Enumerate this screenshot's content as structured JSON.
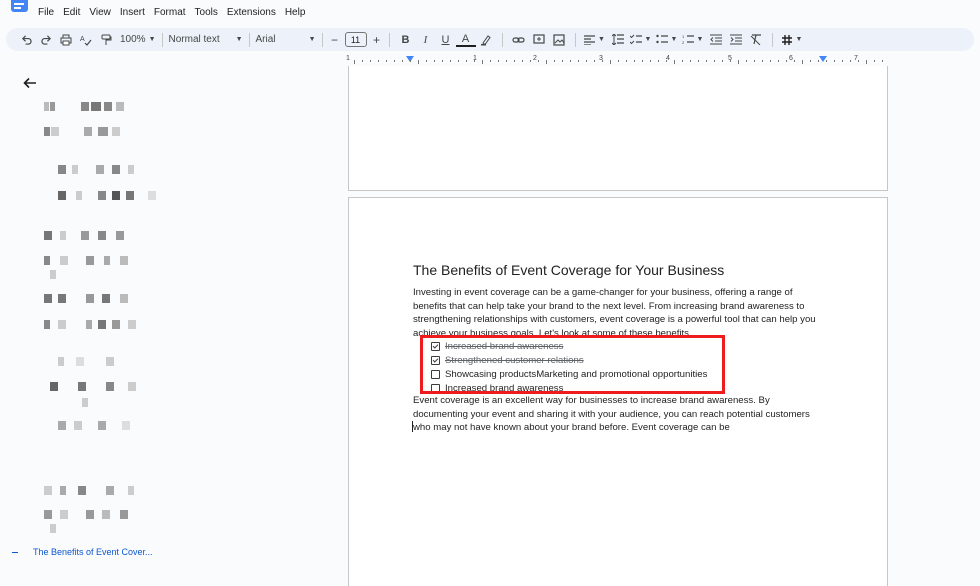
{
  "menu": [
    "File",
    "Edit",
    "View",
    "Insert",
    "Format",
    "Tools",
    "Extensions",
    "Help"
  ],
  "toolbar": {
    "zoom": "100%",
    "style": "Normal text",
    "font": "Arial",
    "font_size": "11",
    "minus": "−",
    "plus": "+"
  },
  "ruler": {
    "numbers": [
      "1",
      "1",
      "2",
      "3",
      "4",
      "5",
      "6",
      "7"
    ]
  },
  "sidebar": {
    "active_heading": "The Benefits of Event Cover..."
  },
  "document": {
    "title": "The Benefits of Event Coverage for Your Business",
    "paragraph1": "Investing in event coverage can be a game-changer for your business, offering a range of benefits that can help take your brand to the next level. From increasing brand awareness to strengthening relationships with customers, event coverage is a powerful tool that can help you achieve your business goals. Let's look at some of these benefits.",
    "checklist": [
      {
        "text": "Increased brand awareness",
        "checked": true
      },
      {
        "text": "Strengthened customer relations",
        "checked": true
      },
      {
        "text": "Showcasing productsMarketing and promotional opportunities",
        "checked": false
      },
      {
        "text": "Increased brand awareness",
        "checked": false
      }
    ],
    "paragraph2": "Event coverage is an excellent way for businesses to increase brand awareness. By documenting your event and sharing it with your audience, you can reach potential customers who may not have known about your brand before. Event coverage can be"
  },
  "colors": {
    "accent": "#0b57d0",
    "highlight_box": "#ee1c1c",
    "toolbar_bg": "#edf2fa"
  }
}
